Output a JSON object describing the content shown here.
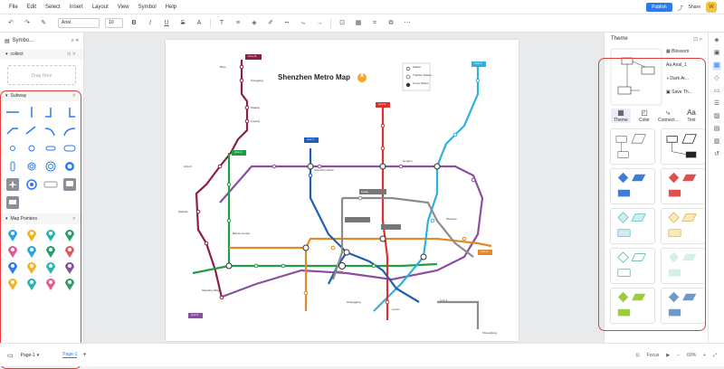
{
  "menu": [
    "File",
    "Edit",
    "Select",
    "Insert",
    "Layout",
    "View",
    "Symbol",
    "Help"
  ],
  "header": {
    "publish": "Publish",
    "share": "Share",
    "avatar": "W"
  },
  "toolbar": {
    "font": "Arial",
    "size": "10"
  },
  "left_panel": {
    "title": "Symbo...",
    "collect": "collect",
    "drag_here": "Drag Here",
    "subway": "Subway",
    "map_pointers": "Map Pointers"
  },
  "map": {
    "title": "Shenzhen Metro Map",
    "legend": [
      "Station",
      "Transfer Station",
      "Cross Station"
    ],
    "lines": [
      {
        "label": "Line 1",
        "color": "#1f9e47"
      },
      {
        "label": "Line 2",
        "color": "#e08a2a"
      },
      {
        "label": "Line 3",
        "color": "#2fb0e0"
      },
      {
        "label": "Line 4",
        "color": "#d9322f"
      },
      {
        "label": "Line 5",
        "color": "#8a4fa0"
      },
      {
        "label": "Line 7",
        "color": "#1d5fb5"
      },
      {
        "label": "Line 9",
        "color": "#8c8c8c"
      },
      {
        "label": "Line 11",
        "color": "#8b1f4a"
      }
    ],
    "stations": [
      "Bitou",
      "Songgang",
      "Shajing",
      "Fuyong",
      "Airport",
      "Bao'an Center",
      "Qianhai",
      "Shenzhen North",
      "Honghu",
      "Shenzhen Bay",
      "Laojie",
      "Huanggang",
      "Futian",
      "Shuiwan",
      "Luohu",
      "Shuanglong"
    ]
  },
  "right_panel": {
    "title": "Theme",
    "items": [
      "Blossom",
      "Arial_1",
      "Dark Ar...",
      "Save Th..."
    ],
    "tabs": [
      "Theme",
      "Color",
      "Connect...",
      "Text"
    ]
  },
  "status": {
    "page_selector": "Page-1",
    "page_tab": "Page-1",
    "focus": "Focus",
    "zoom": "60%"
  }
}
